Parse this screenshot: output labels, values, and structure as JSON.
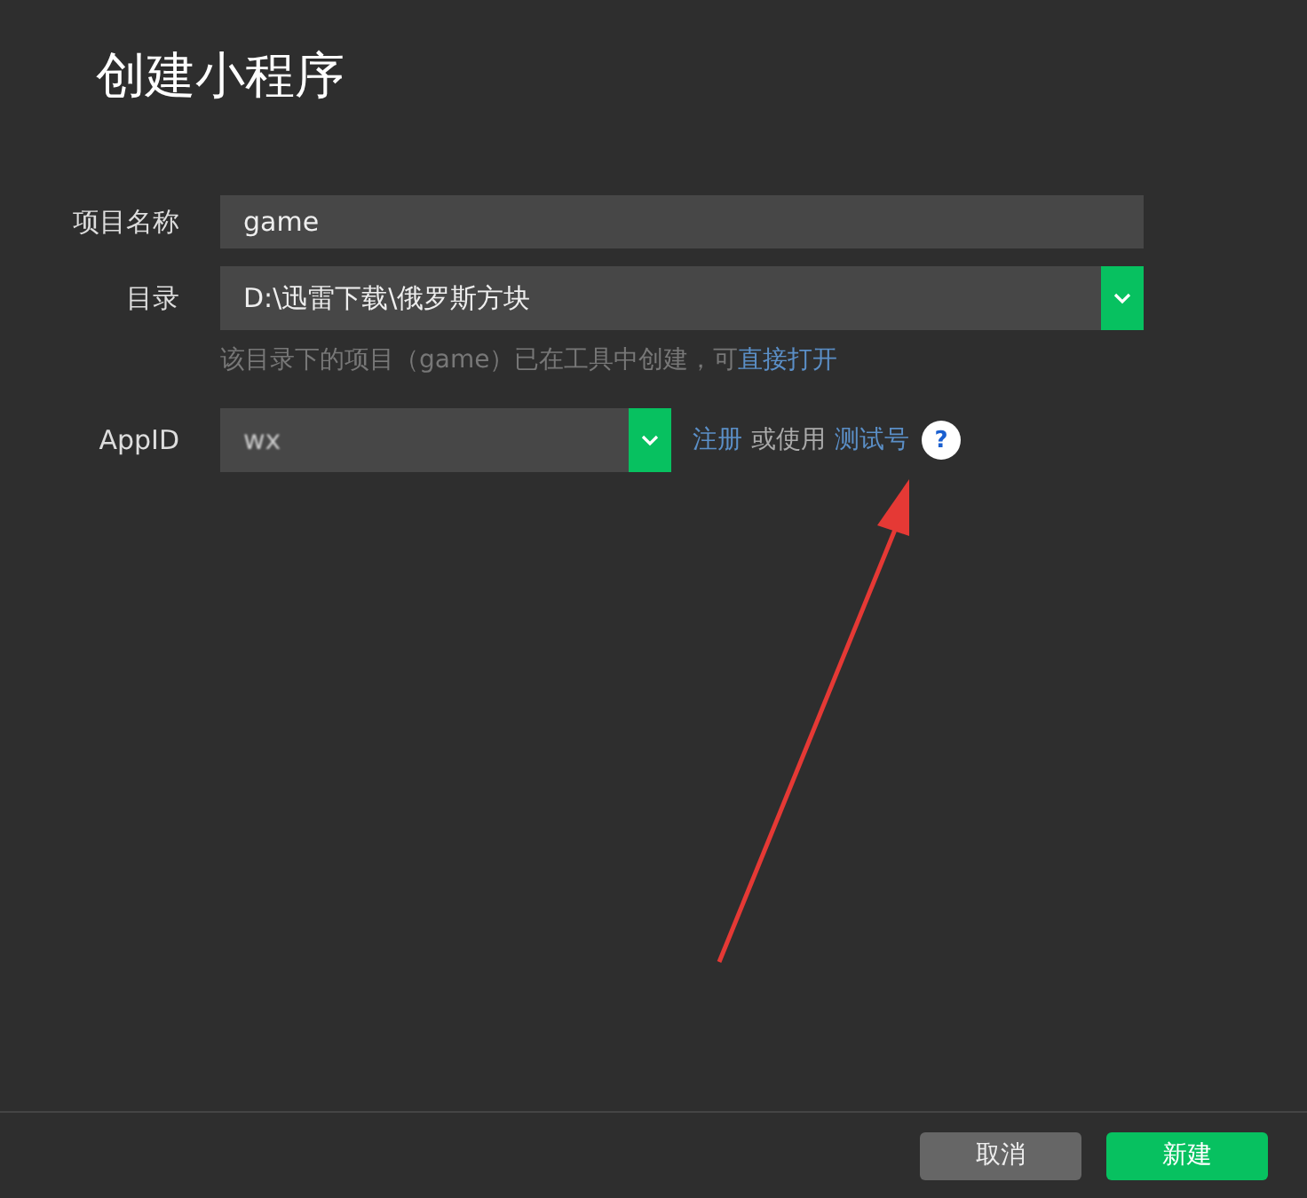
{
  "title": "创建小程序",
  "form": [
    {
      "label": "项目名称",
      "kind": "text",
      "value": "game"
    },
    {
      "label": "目录",
      "kind": "select",
      "value": "D:\\迅雷下载\\俄罗斯方块",
      "hint": "该目录下的项目（game）已在工具中创建，可",
      "hint_link": "直接打开"
    },
    {
      "label": "AppID",
      "kind": "appid",
      "value": "wx",
      "links": [
        {
          "text": "注册",
          "kind": "link"
        },
        {
          "text": "或使用",
          "kind": "plain"
        },
        {
          "text": "测试号",
          "kind": "link"
        }
      ],
      "help": "?"
    }
  ],
  "buttons": [
    {
      "label": "取消",
      "kind": "secondary"
    },
    {
      "label": "新建",
      "kind": "primary"
    }
  ]
}
